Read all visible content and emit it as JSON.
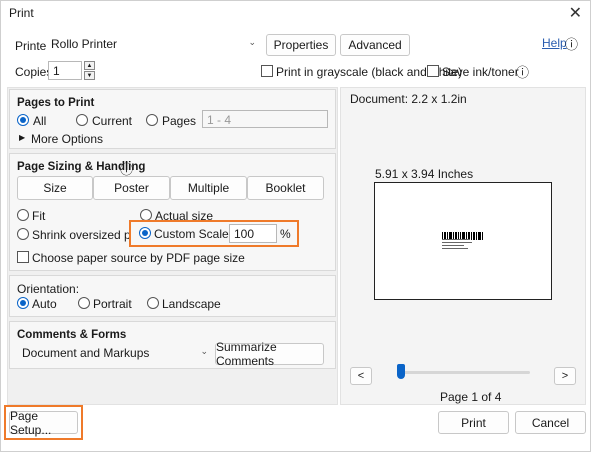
{
  "window": {
    "title": "Print",
    "close_glyph": "✕"
  },
  "printer": {
    "label": "Printer:",
    "value": "Rollo Printer",
    "properties": "Properties",
    "advanced": "Advanced",
    "help": "Help",
    "help_icon": "ⓘ"
  },
  "copies": {
    "label": "Copies:",
    "value": "1"
  },
  "options": {
    "grayscale": "Print in grayscale (black and white)",
    "save_ink": "Save ink/toner",
    "info_icon": "ⓘ"
  },
  "pages_to_print": {
    "heading": "Pages to Print",
    "all": "All",
    "current": "Current",
    "pages": "Pages",
    "pages_placeholder": "1 - 4",
    "more_options": "More Options",
    "selected": "all"
  },
  "sizing": {
    "heading": "Page Sizing & Handling",
    "tabs": [
      "Size",
      "Poster",
      "Multiple",
      "Booklet"
    ],
    "fit": "Fit",
    "actual": "Actual size",
    "shrink": "Shrink oversized pages",
    "custom": "Custom Scale:",
    "custom_value": "100",
    "percent": "%",
    "paper_source": "Choose paper source by PDF page size",
    "selected": "custom"
  },
  "orientation": {
    "heading": "Orientation:",
    "auto": "Auto",
    "portrait": "Portrait",
    "landscape": "Landscape",
    "selected": "auto"
  },
  "comments": {
    "heading": "Comments & Forms",
    "value": "Document and Markups",
    "summarize": "Summarize Comments"
  },
  "preview": {
    "document": "Document: 2.2 x 1.2in",
    "paper": "5.91 x 3.94 Inches",
    "prev": "<",
    "next": ">",
    "page_label": "Page 1 of 4",
    "slider_fraction": 0.0
  },
  "footer": {
    "page_setup": "Page Setup...",
    "print": "Print",
    "cancel": "Cancel"
  },
  "colors": {
    "accent": "#0a64c8",
    "highlight": "#ef7a2a"
  }
}
